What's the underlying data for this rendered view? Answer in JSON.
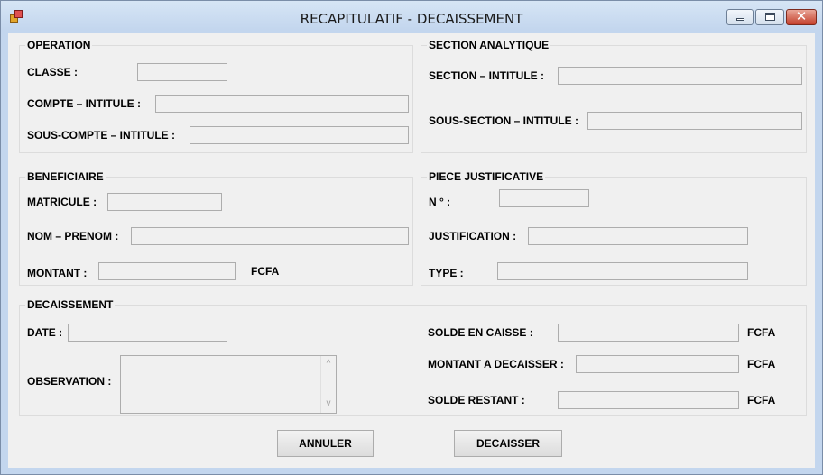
{
  "window": {
    "title": "RECAPITULATIF - DECAISSEMENT",
    "icon": "app-icon",
    "controls": {
      "minimize": "minimize-icon",
      "maximize": "maximize-icon",
      "close": "✕"
    }
  },
  "operation": {
    "title": "OPERATION",
    "classe_label": "CLASSE :",
    "compte_label": "COMPTE – INTITULE :",
    "sous_compte_label": "SOUS-COMPTE – INTITULE :"
  },
  "section": {
    "title": "SECTION ANALYTIQUE",
    "section_label": "SECTION – INTITULE :",
    "sous_section_label": "SOUS-SECTION – INTITULE :"
  },
  "beneficiaire": {
    "title": "BENEFICIAIRE",
    "matricule_label": "MATRICULE :",
    "nom_label": "NOM – PRENOM :",
    "montant_label": "MONTANT :",
    "currency": "FCFA"
  },
  "piece": {
    "title": "PIECE JUSTIFICATIVE",
    "numero_label": "N ° :",
    "justification_label": "JUSTIFICATION :",
    "type_label": "TYPE  :"
  },
  "decaissement": {
    "title": "DECAISSEMENT",
    "date_label": "DATE :",
    "observation_label": "OBSERVATION :",
    "solde_caisse_label": "SOLDE EN CAISSE :",
    "montant_label": "MONTANT A DECAISSER :",
    "solde_restant_label": "SOLDE RESTANT :",
    "currency_1": "FCFA",
    "currency_2": "FCFA",
    "currency_3": "FCFA",
    "scroll_up": "^",
    "scroll_down": "v"
  },
  "actions": {
    "annuler": "ANNULER",
    "decaisser": "DECAISSER"
  }
}
